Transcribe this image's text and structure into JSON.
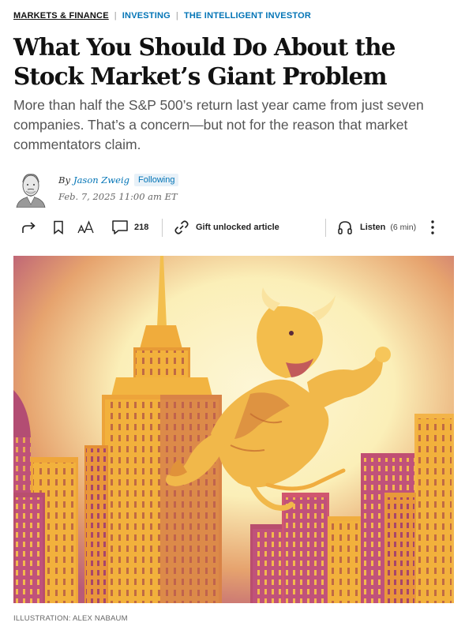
{
  "breadcrumb": {
    "items": [
      "MARKETS & FINANCE",
      "INVESTING",
      "THE INTELLIGENT INVESTOR"
    ],
    "separator": "|"
  },
  "article": {
    "headline": "What You Should Do About the Stock Market’s Giant Problem",
    "dek": "More than half the S&P 500’s return last year came from just seven companies. That’s a concern—but not for the reason that market commentators claim.",
    "byline_prefix": "By",
    "author": "Jason Zweig",
    "follow_label": "Following",
    "date": "Feb. 7, 2025 11:00 am ET"
  },
  "toolbar": {
    "comments_count": "218",
    "gift_label": "Gift unlocked article",
    "listen_label": "Listen",
    "listen_duration": "(6 min)",
    "icons": [
      "share-icon",
      "bookmark-icon",
      "text-size-icon",
      "comment-icon",
      "link-icon",
      "headphones-icon",
      "more-icon"
    ]
  },
  "image": {
    "caption": "ILLUSTRATION: ALEX NABAUM"
  },
  "colors": {
    "accent_blue": "#0274b6",
    "magenta": "#b0456b",
    "yellow": "#f6c140",
    "cream": "#fbf0c8"
  }
}
